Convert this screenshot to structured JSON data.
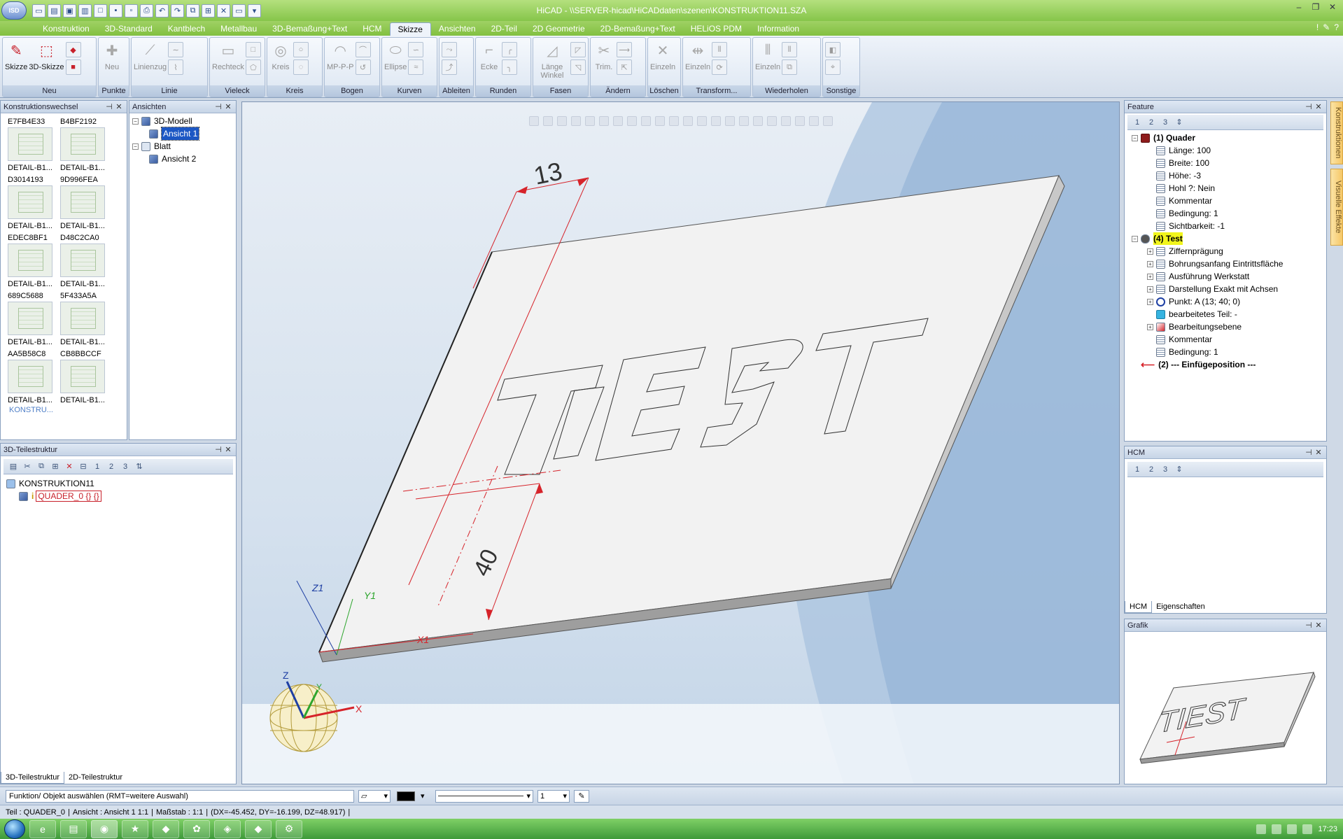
{
  "window": {
    "title": "HiCAD - \\\\SERVER-hicad\\HiCADdaten\\szenen\\KONSTRUKTION11.SZA",
    "app_button": "ISD"
  },
  "ribbon_tabs": [
    "Konstruktion",
    "3D-Standard",
    "Kantblech",
    "Metallbau",
    "3D-Bemaßung+Text",
    "HCM",
    "Skizze",
    "Ansichten",
    "2D-Teil",
    "2D Geometrie",
    "2D-Bemaßung+Text",
    "HELiOS PDM",
    "Information"
  ],
  "active_tab": "Skizze",
  "ribbon_groups": [
    {
      "label": "Neu",
      "buttons": [
        "Skizze",
        "3D-Skizze"
      ]
    },
    {
      "label": "Punkte",
      "buttons": [
        "Neu"
      ]
    },
    {
      "label": "Linie",
      "buttons": [
        "Linienzug"
      ]
    },
    {
      "label": "Vieleck",
      "buttons": [
        "Rechteck"
      ]
    },
    {
      "label": "Kreis",
      "buttons": [
        "Kreis"
      ]
    },
    {
      "label": "Bogen",
      "buttons": [
        "MP-P-P"
      ]
    },
    {
      "label": "Kurven",
      "buttons": [
        "Ellipse"
      ]
    },
    {
      "label": "Ableiten",
      "buttons": []
    },
    {
      "label": "Runden",
      "buttons": [
        "Ecke"
      ]
    },
    {
      "label": "Fasen",
      "buttons": [
        "Länge Winkel"
      ]
    },
    {
      "label": "Ändern",
      "buttons": [
        "Trim."
      ]
    },
    {
      "label": "Löschen",
      "buttons": [
        "Einzeln"
      ]
    },
    {
      "label": "Transform...",
      "buttons": [
        "Einzeln"
      ]
    },
    {
      "label": "Wiederholen",
      "buttons": [
        "Einzeln"
      ]
    },
    {
      "label": "Sonstige",
      "buttons": []
    }
  ],
  "panels": {
    "konstruktionswechsel": {
      "title": "Konstruktionswechsel",
      "items": [
        {
          "id": "E7FB4E33",
          "name": "DETAIL-B1..."
        },
        {
          "id": "B4BF2192",
          "name": "DETAIL-B1..."
        },
        {
          "id": "D3014193",
          "name": "DETAIL-B1..."
        },
        {
          "id": "9D996FEA",
          "name": "DETAIL-B1..."
        },
        {
          "id": "EDEC8BF1",
          "name": "DETAIL-B1..."
        },
        {
          "id": "D48C2CA0",
          "name": "DETAIL-B1..."
        },
        {
          "id": "689C5688",
          "name": "DETAIL-B1..."
        },
        {
          "id": "5F433A5A",
          "name": "DETAIL-B1..."
        },
        {
          "id": "AA5B58C8",
          "name": "DETAIL-B1..."
        },
        {
          "id": "CB8BBCCF",
          "name": "DETAIL-B1..."
        }
      ],
      "last": "KONSTRU..."
    },
    "ansichten": {
      "title": "Ansichten",
      "model": "3D-Modell",
      "view1": "Ansicht 1",
      "sheet": "Blatt",
      "view2": "Ansicht 2"
    },
    "teilestruktur": {
      "title": "3D-Teilestruktur",
      "root": "KONSTRUKTION11",
      "part": "QUADER_0 {} {}",
      "tabs": [
        "3D-Teilestruktur",
        "2D-Teilestruktur"
      ]
    },
    "feature": {
      "title": "Feature",
      "nodes": [
        {
          "text": "(1) Quader",
          "level": 0,
          "bold": true,
          "icon": "cube-red-icon"
        },
        {
          "text": "Länge: 100",
          "level": 1,
          "icon": "table-icon"
        },
        {
          "text": "Breite: 100",
          "level": 1,
          "icon": "table-icon"
        },
        {
          "text": "Höhe: -3",
          "level": 1,
          "icon": "table-icon"
        },
        {
          "text": "Hohl ?: Nein",
          "level": 1,
          "icon": "table-icon"
        },
        {
          "text": "Kommentar",
          "level": 1,
          "icon": "table-icon"
        },
        {
          "text": "Bedingung: 1",
          "level": 1,
          "icon": "table-icon"
        },
        {
          "text": "Sichtbarkeit: -1",
          "level": 1,
          "icon": "table-icon"
        },
        {
          "text": "(4) Test",
          "level": 0,
          "bold": true,
          "highlight": true,
          "icon": "feature-icon"
        },
        {
          "text": "Ziffernprägung",
          "level": 1,
          "icon": "table-icon",
          "expand": true
        },
        {
          "text": "Bohrungsanfang Eintrittsfläche",
          "level": 1,
          "icon": "table-icon",
          "expand": true
        },
        {
          "text": "Ausführung Werkstatt",
          "level": 1,
          "icon": "table-icon",
          "expand": true
        },
        {
          "text": "Darstellung Exakt mit Achsen",
          "level": 1,
          "icon": "table-icon",
          "expand": true
        },
        {
          "text": "Punkt: A  (13; 40; 0)",
          "level": 1,
          "icon": "point-icon",
          "expand": true
        },
        {
          "text": "bearbeitetes Teil: -",
          "level": 1,
          "icon": "part-icon"
        },
        {
          "text": "Bearbeitungsebene",
          "level": 1,
          "icon": "plane-icon",
          "expand": true
        },
        {
          "text": "Kommentar",
          "level": 1,
          "icon": "table-icon"
        },
        {
          "text": "Bedingung: 1",
          "level": 1,
          "icon": "table-icon"
        },
        {
          "text": "(2) --- Einfügeposition ---",
          "level": 0,
          "bold": true,
          "icon": "arrow-left-icon"
        }
      ]
    },
    "hcm": {
      "title": "HCM",
      "tabs": [
        "HCM",
        "Eigenschaften"
      ]
    },
    "grafik": {
      "title": "Grafik"
    }
  },
  "viewport": {
    "dim_top": "13",
    "dim_side": "40",
    "text_on_plate": "TIEST",
    "axis_x": "X",
    "axis_y": "Y",
    "axis_z": "Z",
    "ucs_x": "X1",
    "ucs_y": "Y1",
    "ucs_z": "Z1"
  },
  "side_tabs": [
    "Konstruktionen",
    "Visuelle Effekte"
  ],
  "cmd": {
    "prompt": "Funktion/ Objekt auswählen (RMT=weitere Auswahl)",
    "width": "1"
  },
  "status": {
    "part": "Teil : QUADER_0",
    "view": "Ansicht : Ansicht 1 1:1",
    "scale": "Maßstab : 1:1",
    "delta": "(DX=-45.452, DY=-16.199, DZ=48.917)"
  },
  "clock": "17:23",
  "colors": {
    "accent": "#86c54a",
    "highlight": "#f1f51c",
    "dimension": "#d6232a"
  }
}
